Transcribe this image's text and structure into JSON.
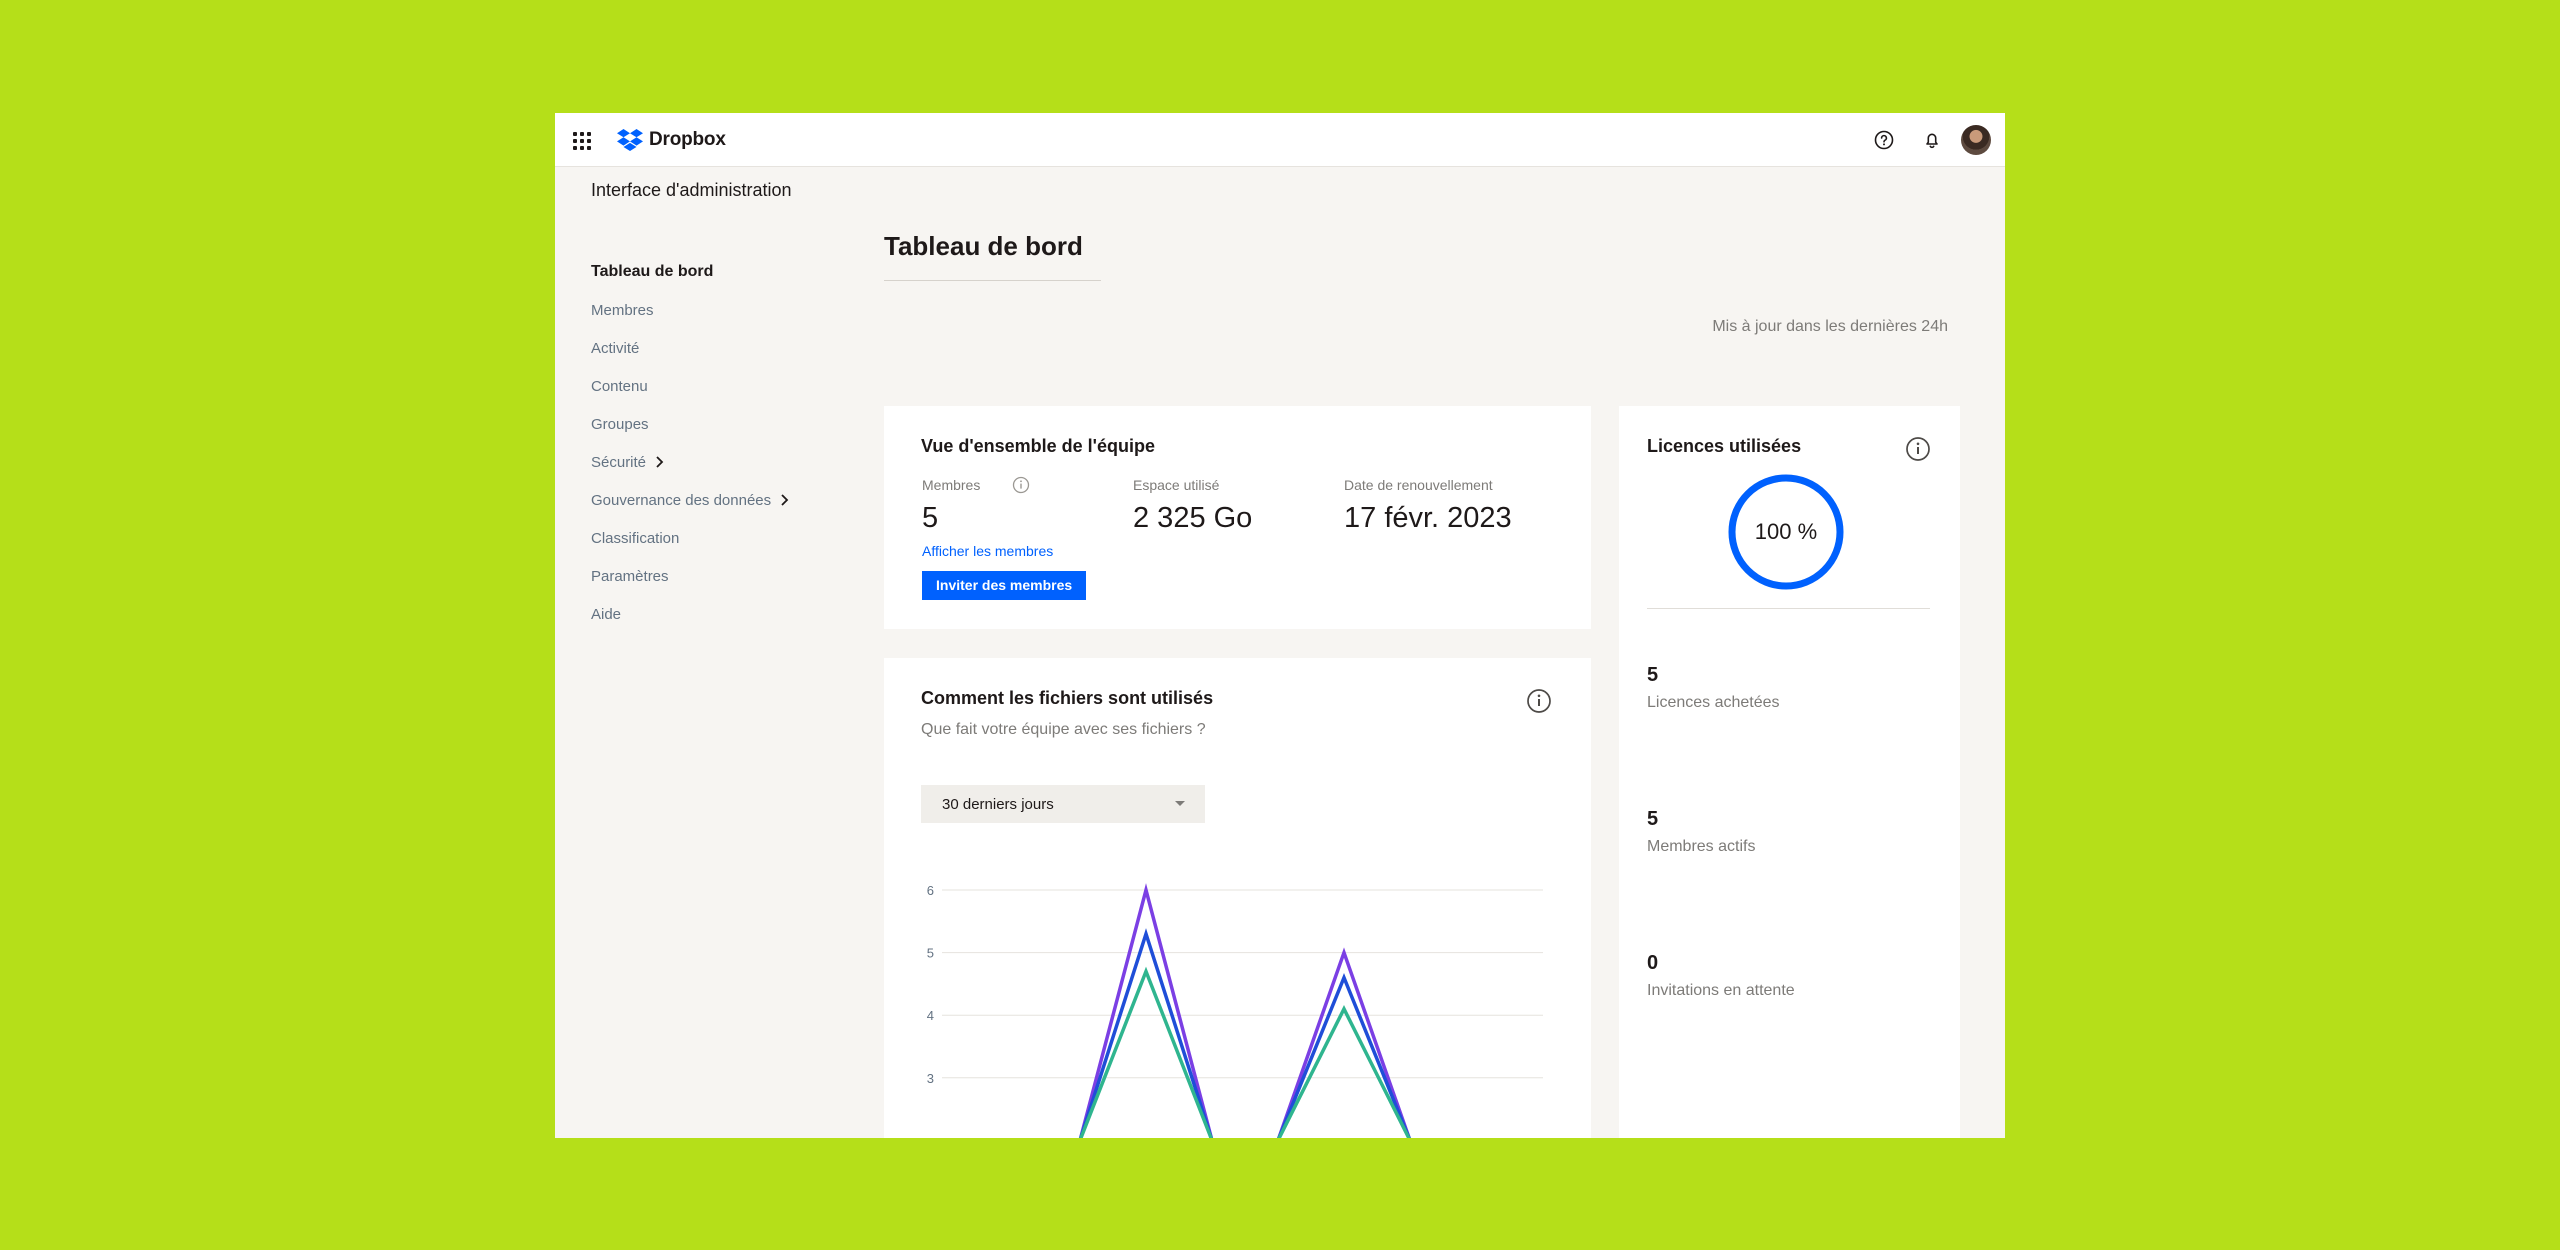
{
  "app": {
    "logo_text": "Dropbox",
    "admin_title": "Interface d'administration"
  },
  "sidebar": {
    "items": [
      {
        "label": "Tableau de bord"
      },
      {
        "label": "Membres"
      },
      {
        "label": "Activité"
      },
      {
        "label": "Contenu"
      },
      {
        "label": "Groupes"
      },
      {
        "label": "Sécurité"
      },
      {
        "label": "Gouvernance des données"
      },
      {
        "label": "Classification"
      },
      {
        "label": "Paramètres"
      },
      {
        "label": "Aide"
      }
    ]
  },
  "page": {
    "title": "Tableau de bord",
    "updated": "Mis à jour dans les dernières 24h"
  },
  "team": {
    "title": "Vue d'ensemble de l'équipe",
    "members_label": "Membres",
    "members_value": "5",
    "space_label": "Espace utilisé",
    "space_value": "2 325 Go",
    "renewal_label": "Date de renouvellement",
    "renewal_value": "17 févr. 2023",
    "view_members_link": "Afficher les membres",
    "invite_button": "Inviter des membres"
  },
  "files": {
    "title": "Comment les fichiers sont utilisés",
    "subtitle": "Que fait votre équipe avec ses fichiers ?",
    "period_select": "30 derniers jours"
  },
  "licenses": {
    "title": "Licences utilisées",
    "usage_label": "100 %",
    "usage_fraction": 1.0,
    "purchased_value": "5",
    "purchased_label": "Licences achetées",
    "active_value": "5",
    "active_label": "Membres actifs",
    "pending_value": "0",
    "pending_label": "Invitations en attente"
  },
  "colors": {
    "accent": "#0061fe",
    "background": "#b5df19",
    "series_purple": "#7b3fe4",
    "series_blue": "#1f4ed8",
    "series_green": "#2fb58f"
  },
  "chart_data": {
    "type": "line",
    "y_ticks": [
      "6",
      "5",
      "4",
      "3"
    ],
    "ylim": [
      2,
      6
    ],
    "x": [
      0,
      1,
      2,
      3,
      4,
      5,
      6,
      7,
      8
    ],
    "series": [
      {
        "values": [
          2,
          2,
          2,
          6,
          2,
          2,
          5,
          2,
          2
        ]
      },
      {
        "values": [
          2,
          2,
          2,
          5.3,
          2,
          2,
          4.6,
          2,
          2
        ]
      },
      {
        "values": [
          2,
          2,
          2,
          4.7,
          2,
          2,
          4.1,
          2,
          2
        ]
      }
    ]
  }
}
